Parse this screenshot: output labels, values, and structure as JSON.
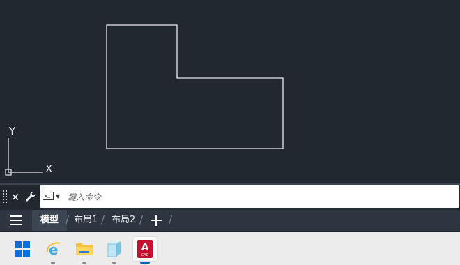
{
  "drawing": {
    "ucs_x_label": "X",
    "ucs_y_label": "Y"
  },
  "command": {
    "placeholder": "鍵入命令",
    "close_icon": "close-icon",
    "settings_icon": "wrench-icon"
  },
  "layout_tabs": {
    "menu_icon": "hamburger-menu-icon",
    "tabs": [
      {
        "label": "模型",
        "active": true
      },
      {
        "label": "布局1",
        "active": false
      },
      {
        "label": "布局2",
        "active": false
      }
    ],
    "add_icon": "plus-icon"
  },
  "taskbar": {
    "items": [
      {
        "icon": "windows-start-icon",
        "running": false
      },
      {
        "icon": "internet-explorer-icon",
        "running": true
      },
      {
        "icon": "file-explorer-icon",
        "running": true
      },
      {
        "icon": "3d-box-app-icon",
        "running": true
      },
      {
        "icon": "autocad-icon",
        "label": "CAD",
        "running": true,
        "active": true
      }
    ]
  },
  "colors": {
    "canvas_bg": "#212830",
    "line_color": "#ffffff",
    "layout_bar": "#2d3540",
    "taskbar": "#ececec",
    "autocad_red": "#c8102e"
  }
}
